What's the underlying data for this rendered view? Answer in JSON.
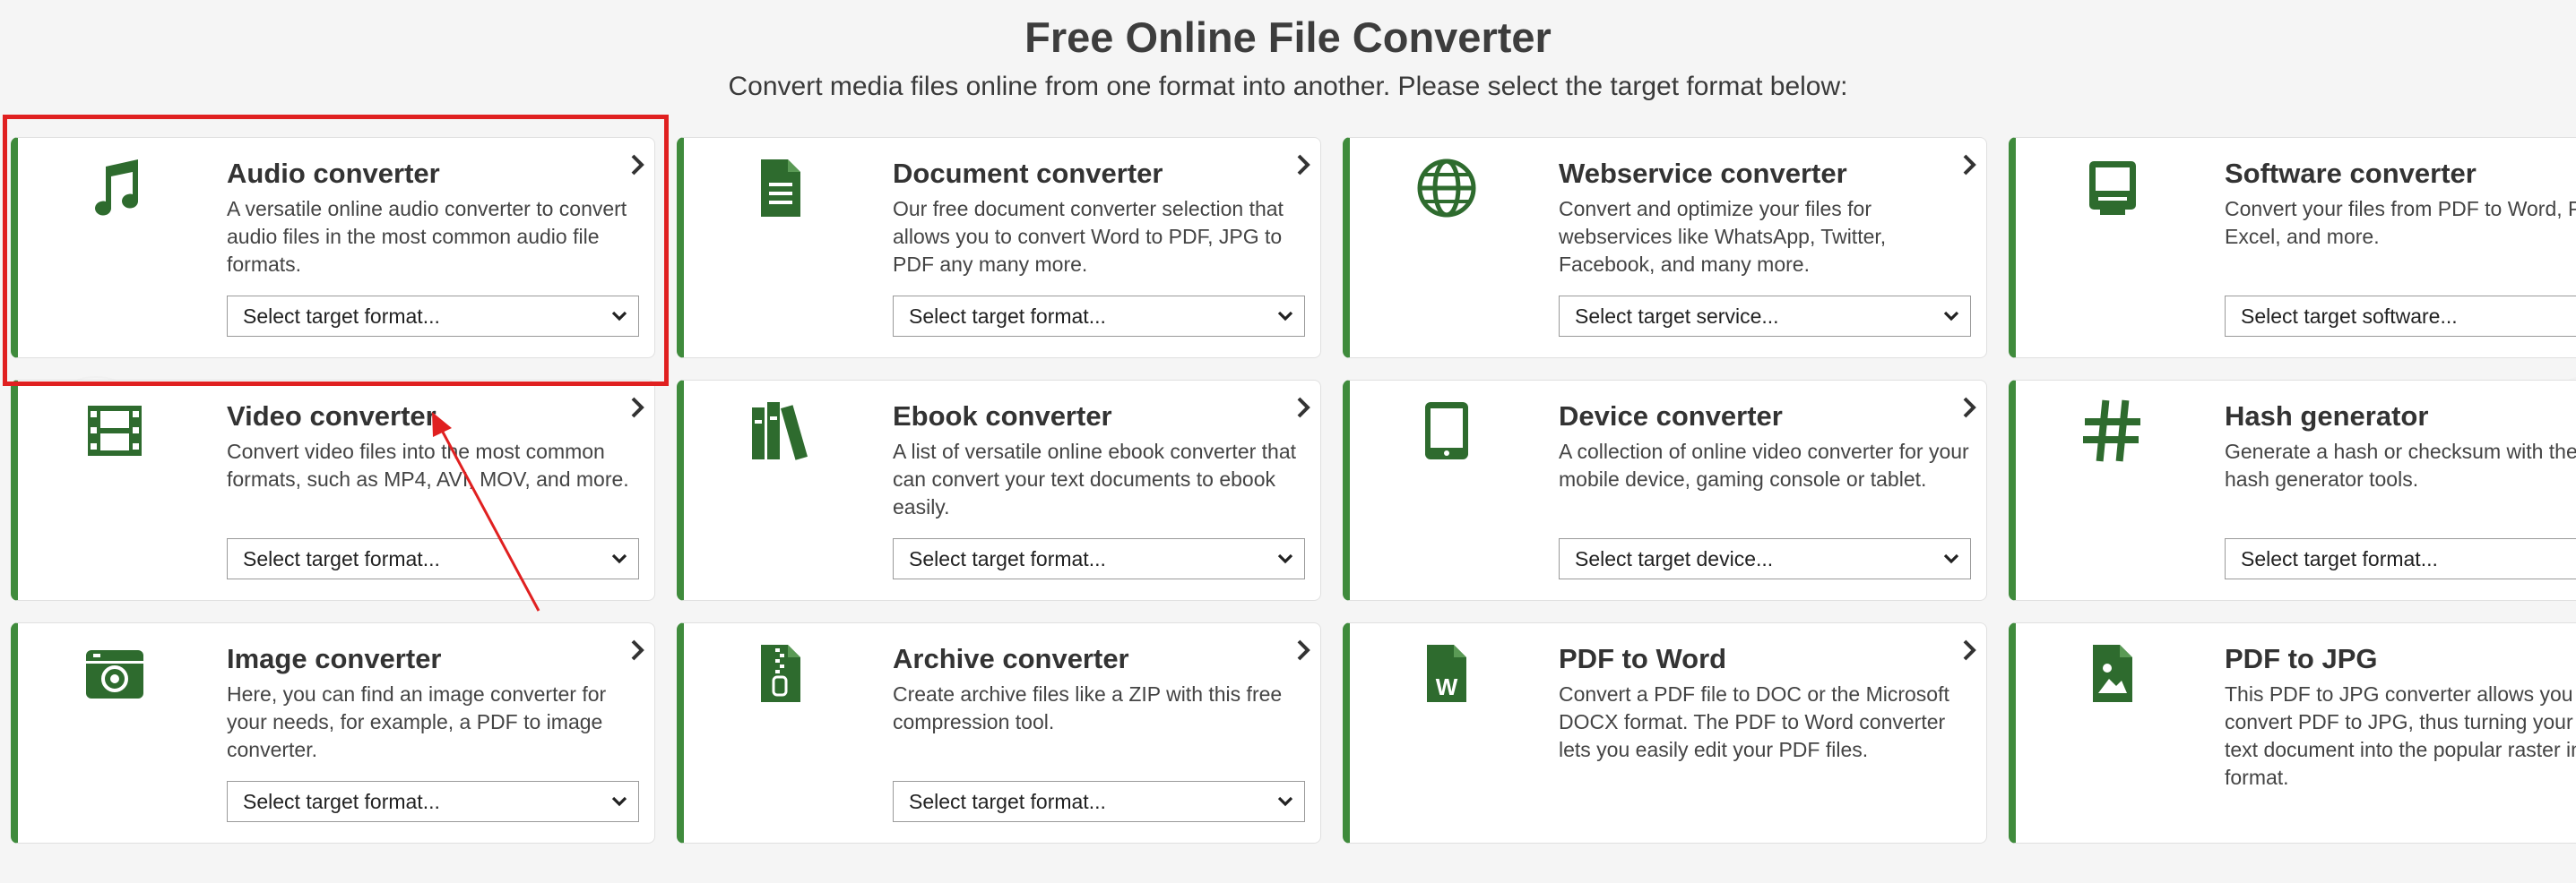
{
  "header": {
    "title": "Free Online File Converter",
    "subtitle": "Convert media files online from one format into another. Please select the target format below:"
  },
  "colors": {
    "accent": "#3f8b3c",
    "icon": "#2e6b2e",
    "annotation": "#e02020"
  },
  "cards": [
    {
      "title": "Audio converter",
      "icon": "music-note-icon",
      "desc": "A versatile online audio converter to convert audio files in the most common audio file formats.",
      "select": "Select target format...",
      "has_arrow": true
    },
    {
      "title": "Document converter",
      "icon": "document-icon",
      "desc": "Our free document converter selection that allows you to convert Word to PDF, JPG to PDF any many more.",
      "select": "Select target format...",
      "has_arrow": true
    },
    {
      "title": "Webservice converter",
      "icon": "globe-icon",
      "desc": "Convert and optimize your files for webservices like WhatsApp, Twitter, Facebook, and many more.",
      "select": "Select target service...",
      "has_arrow": true
    },
    {
      "title": "Software converter",
      "icon": "computer-icon",
      "desc": "Convert your files from PDF to Word, PDF to Excel, and more.",
      "select": "Select target software...",
      "has_arrow": true
    },
    {
      "title": "Video converter",
      "icon": "film-icon",
      "desc": "Convert video files into the most common formats, such as MP4, AVI, MOV, and more.",
      "select": "Select target format...",
      "has_arrow": true
    },
    {
      "title": "Ebook converter",
      "icon": "books-icon",
      "desc": "A list of versatile online ebook converter that can convert your text documents to ebook easily.",
      "select": "Select target format...",
      "has_arrow": true
    },
    {
      "title": "Device converter",
      "icon": "tablet-icon",
      "desc": "A collection of online video converter for your mobile device, gaming console or tablet.",
      "select": "Select target device...",
      "has_arrow": true
    },
    {
      "title": "Hash generator",
      "icon": "hash-icon",
      "desc": "Generate a hash or checksum with these hash generator tools.",
      "select": "Select target format...",
      "has_arrow": true
    },
    {
      "title": "Image converter",
      "icon": "camera-icon",
      "desc": "Here, you can find an image converter for your needs, for example, a PDF to image converter.",
      "select": "Select target format...",
      "has_arrow": true
    },
    {
      "title": "Archive converter",
      "icon": "zip-file-icon",
      "desc": "Create archive files like a ZIP with this free compression tool.",
      "select": "Select target format...",
      "has_arrow": true
    },
    {
      "title": "PDF to Word",
      "icon": "word-file-icon",
      "desc": "Convert a PDF file to DOC or the Microsoft DOCX format. The PDF to Word converter lets you easily edit your PDF files.",
      "select": "",
      "has_arrow": true
    },
    {
      "title": "PDF to JPG",
      "icon": "image-file-icon",
      "desc": "This PDF to JPG converter allows you to convert PDF to JPG, thus turning your PDF text document into the popular raster image format.",
      "select": "",
      "has_arrow": false
    }
  ]
}
